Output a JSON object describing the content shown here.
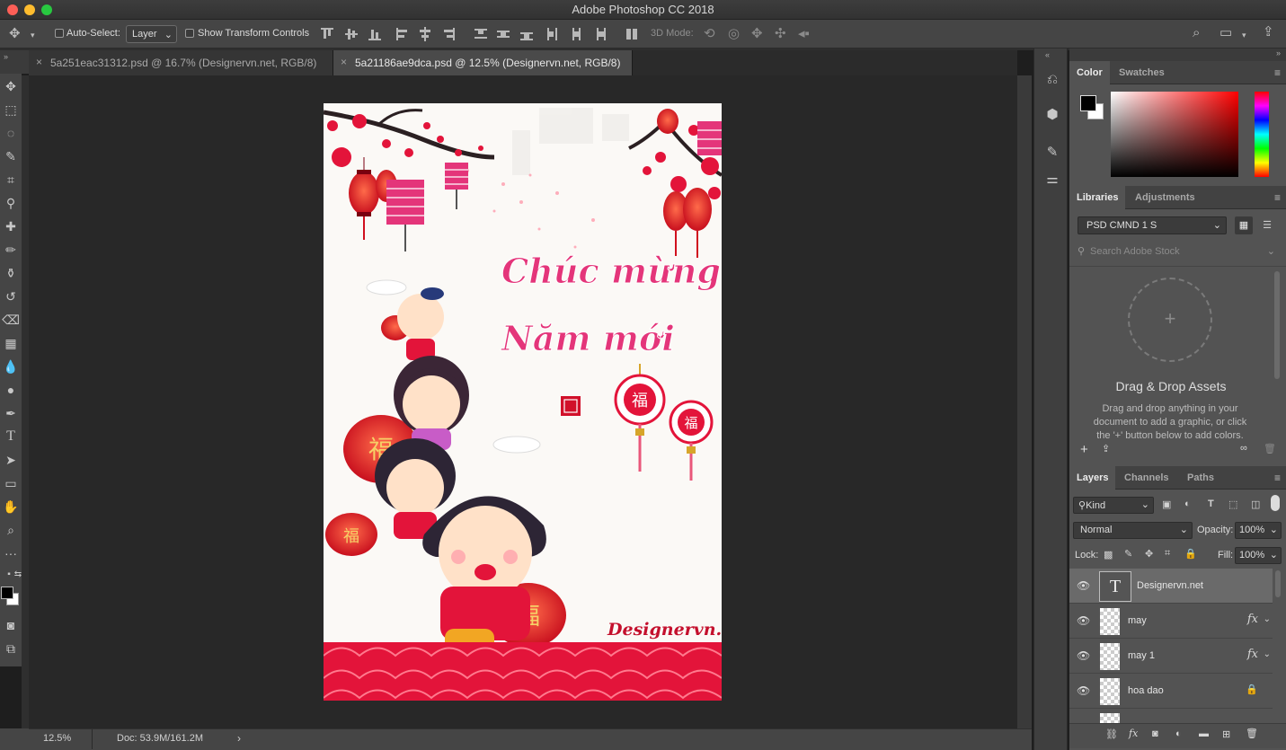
{
  "window": {
    "title": "Adobe Photoshop CC 2018"
  },
  "options_bar": {
    "auto_select_label": "Auto-Select:",
    "auto_select_value": "Layer",
    "show_transform_label": "Show Transform Controls",
    "mode_3d_label": "3D Mode:"
  },
  "tabs": [
    {
      "label": "5a251eac31312.psd @ 16.7% (Designervn.net, RGB/8)",
      "active": false
    },
    {
      "label": "5a21186ae9dca.psd @ 12.5% (Designervn.net, RGB/8)",
      "active": true
    }
  ],
  "canvas": {
    "greeting_line1": "Chúc mừng",
    "greeting_line2": "Năm mới",
    "watermark": "Designervn.net",
    "fortune_char": "福",
    "colors": {
      "red": "#e3143a",
      "pink": "#e4357a",
      "paper": "#fbf9f6"
    }
  },
  "status": {
    "zoom": "12.5%",
    "doc": "Doc: 53.9M/161.2M"
  },
  "color_panel": {
    "tabs": [
      "Color",
      "Swatches"
    ]
  },
  "libraries_panel": {
    "tabs": [
      "Libraries",
      "Adjustments"
    ],
    "library_select": "PSD CMND 1 S",
    "search_placeholder": "Search Adobe Stock",
    "dropzone_title": "Drag & Drop Assets",
    "dropzone_text": "Drag and drop anything in your document to add a graphic, or click the '+' button below to add colors."
  },
  "layers_panel": {
    "tabs": [
      "Layers",
      "Channels",
      "Paths"
    ],
    "filter_kind": "Kind",
    "blend_mode": "Normal",
    "opacity_label": "Opacity:",
    "opacity_value": "100%",
    "lock_label": "Lock:",
    "fill_label": "Fill:",
    "fill_value": "100%",
    "fx_label": "fx",
    "layers": [
      {
        "name": "Designervn.net",
        "type": "text",
        "selected": true
      },
      {
        "name": "may",
        "fx": true
      },
      {
        "name": "may 1",
        "fx": true
      },
      {
        "name": "hoa dao",
        "locked": true
      }
    ]
  }
}
